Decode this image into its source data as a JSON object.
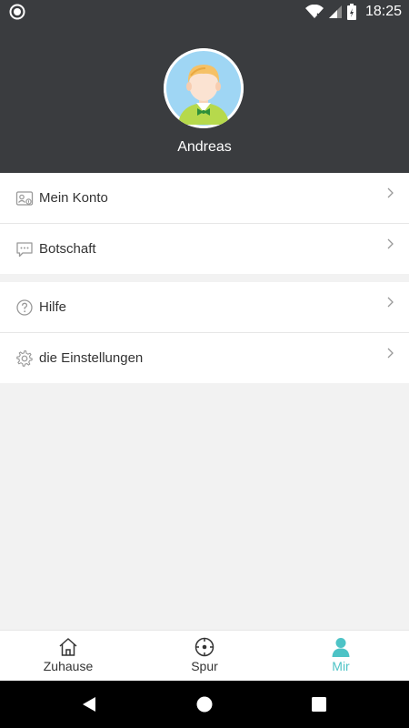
{
  "status_bar": {
    "time": "18:25"
  },
  "profile": {
    "name": "Andreas"
  },
  "menu": {
    "group1": [
      {
        "label": "Mein Konto",
        "icon": "id-card-icon"
      },
      {
        "label": "Botschaft",
        "icon": "message-icon"
      }
    ],
    "group2": [
      {
        "label": "Hilfe",
        "icon": "help-icon"
      },
      {
        "label": "die Einstellungen",
        "icon": "gear-icon"
      }
    ]
  },
  "tabs": [
    {
      "label": "Zuhause",
      "icon": "home-icon",
      "active": false
    },
    {
      "label": "Spur",
      "icon": "target-icon",
      "active": false
    },
    {
      "label": "Mir",
      "icon": "person-icon",
      "active": true
    }
  ],
  "colors": {
    "header": "#3a3c3f",
    "accent": "#4dc3c6",
    "background": "#f2f2f2"
  }
}
